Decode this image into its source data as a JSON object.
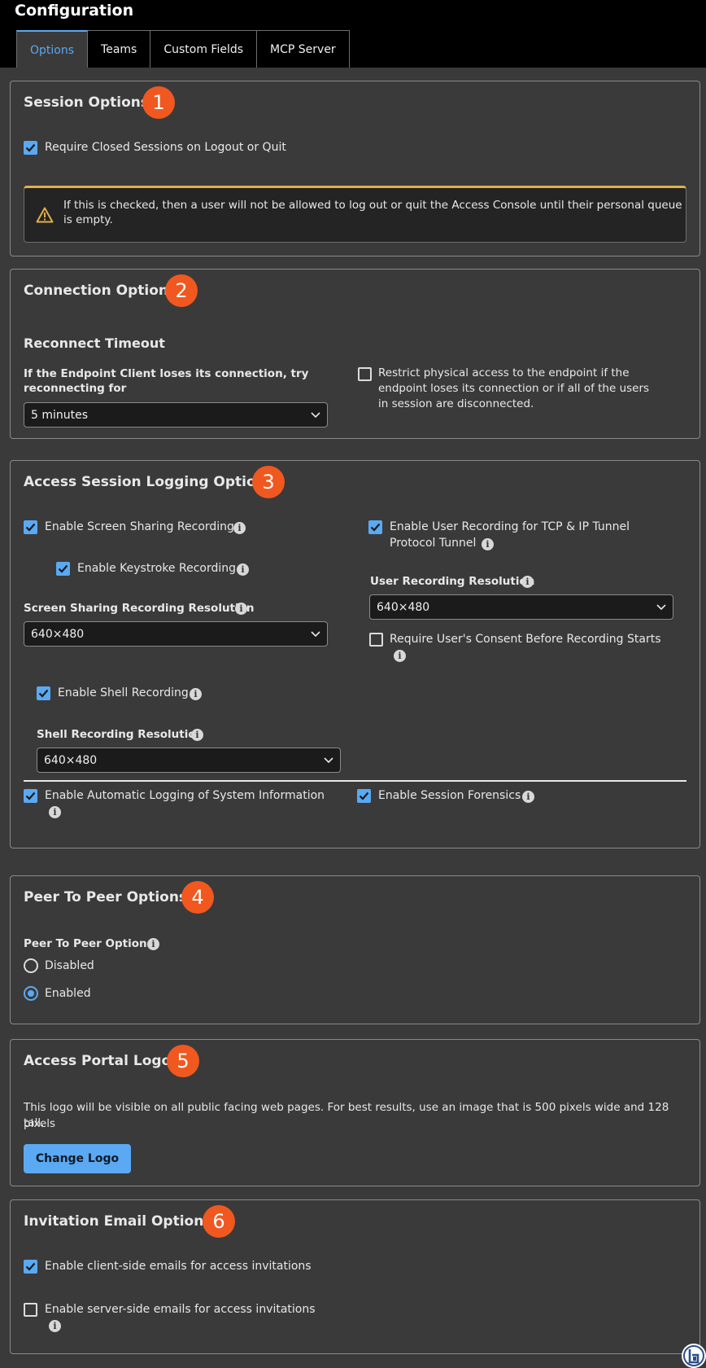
{
  "header": {
    "title": "Configuration"
  },
  "tabs": [
    {
      "label": "Options",
      "active": true
    },
    {
      "label": "Teams"
    },
    {
      "label": "Custom Fields"
    },
    {
      "label": "MCP Server"
    }
  ],
  "session": {
    "title": "Session Options",
    "badge": "1",
    "require_closed": {
      "label": "Require Closed Sessions on Logout or Quit",
      "checked": true
    },
    "warning_line1": "If this is checked, then a user will not be allowed to log out or quit the Access Console until their personal queue",
    "warning_line2": "is empty."
  },
  "connection": {
    "title": "Connection Options",
    "badge": "2",
    "reconnect_heading": "Reconnect Timeout",
    "reconnect_label_line1": "If the Endpoint Client loses its connection, try",
    "reconnect_label_line2": "reconnecting for",
    "reconnect_value": "5 minutes",
    "restrict": {
      "line1": "Restrict physical access to the endpoint if the",
      "line2": "endpoint loses its connection or if all of the users",
      "line3": "in session are disconnected.",
      "checked": false
    }
  },
  "logging": {
    "title": "Access Session Logging Options",
    "badge": "3",
    "screen_sharing": {
      "label": "Enable Screen Sharing Recording",
      "checked": true
    },
    "keystroke": {
      "label": "Enable Keystroke Recording",
      "checked": true
    },
    "screen_resolution_label": "Screen Sharing Recording Resolution",
    "screen_resolution_value": "640×480",
    "user_recording": {
      "line1": "Enable User Recording for TCP & IP Tunnel",
      "line2": "Protocol Tunnel",
      "checked": true
    },
    "user_resolution_label": "User Recording Resolution",
    "user_resolution_value": "640×480",
    "consent": {
      "label": "Require User's Consent Before Recording Starts",
      "checked": false
    },
    "shell": {
      "label": "Enable Shell Recording",
      "checked": true
    },
    "shell_resolution_label": "Shell Recording Resolution",
    "shell_resolution_value": "640×480",
    "auto_logging": {
      "label": "Enable Automatic Logging of System Information",
      "checked": true
    },
    "forensics": {
      "label": "Enable Session Forensics",
      "checked": true
    }
  },
  "p2p": {
    "title": "Peer To Peer Options",
    "badge": "4",
    "field_label": "Peer To Peer Options",
    "options": [
      {
        "label": "Disabled",
        "selected": false
      },
      {
        "label": "Enabled",
        "selected": true
      }
    ]
  },
  "logo": {
    "title": "Access Portal Logo",
    "badge": "5",
    "desc_line1": "This logo will be visible on all public facing web pages. For best results, use an image that is 500 pixels wide and 128 pixels",
    "desc_line2": "tall.",
    "button": "Change Logo"
  },
  "invitation": {
    "title": "Invitation Email Options",
    "badge": "6",
    "client_side": {
      "label": "Enable client-side emails for access invitations",
      "checked": true
    },
    "server_side": {
      "label": "Enable server-side emails for access invitations",
      "checked": false
    }
  },
  "colors": {
    "accent": "#5aa9f2",
    "badge": "#f0581f",
    "warning": "#e0b04c",
    "panel": "#3a3a3a"
  },
  "icons": [
    "check-icon",
    "info-icon",
    "warning-icon",
    "chevron-down-icon",
    "brand-logo-icon"
  ]
}
